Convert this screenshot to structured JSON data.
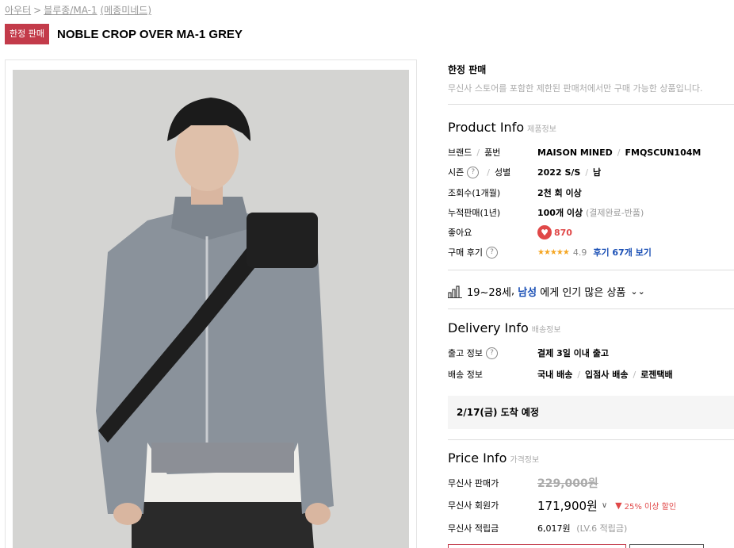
{
  "breadcrumb": {
    "cat1": "아우터",
    "sep": ">",
    "cat2": "블루종/MA-1",
    "brand": "(메종미네드)"
  },
  "badge": "한정 판매",
  "product_name": "NOBLE CROP OVER MA-1 GREY",
  "limited": {
    "title": "한정 판매",
    "desc": "무신사 스토어를 포함한 제한된 판매처에서만 구매 가능한 상품입니다."
  },
  "product_info": {
    "title": "Product Info",
    "sub": "제품정보",
    "brand_label": "브랜드",
    "sku_label": "품번",
    "brand": "MAISON MINED",
    "sku": "FMQSCUN104M",
    "season_label": "시즌",
    "gender_label": "성별",
    "season": "2022 S/S",
    "gender": "남",
    "views_label": "조회수(1개월)",
    "views": "2천 회 이상",
    "sales_label": "누적판매(1년)",
    "sales": "100개 이상",
    "sales_note": "(결제완료-반품)",
    "likes_label": "좋아요",
    "likes": "870",
    "review_label": "구매 후기",
    "stars": "★★★★★",
    "rating": "4.9",
    "review_link": "후기 67개 보기"
  },
  "popular": {
    "age": "19~28세",
    "comma": ",",
    "gender": "남성",
    "text": "에게 인기 많은 상품"
  },
  "delivery": {
    "title": "Delivery Info",
    "sub": "배송정보",
    "ship_label": "출고 정보",
    "ship": "결제 3일 이내 출고",
    "method_label": "배송 정보",
    "method1": "국내 배송",
    "method2": "입점사 배송",
    "method3": "로젠택배",
    "arrival": "2/17(금) 도착 예정"
  },
  "price_info": {
    "title": "Price Info",
    "sub": "가격정보",
    "sale_label": "무신사 판매가",
    "sale": "229,000원",
    "member_label": "무신사 회원가",
    "member": "171,900원",
    "discount": "25% 이상 할인",
    "points_label": "무신사 적립금",
    "points": "6,017원",
    "points_note": "(LV.6 적립금)"
  },
  "icons": {
    "question": "?",
    "heart": "♥",
    "chart": "bar-chart-icon"
  },
  "colors": {
    "badge": "#c33b4a",
    "accent_red": "#e04848",
    "link_blue": "#1a4fb5",
    "star": "#f5a623",
    "jacket": "#8a929b"
  }
}
